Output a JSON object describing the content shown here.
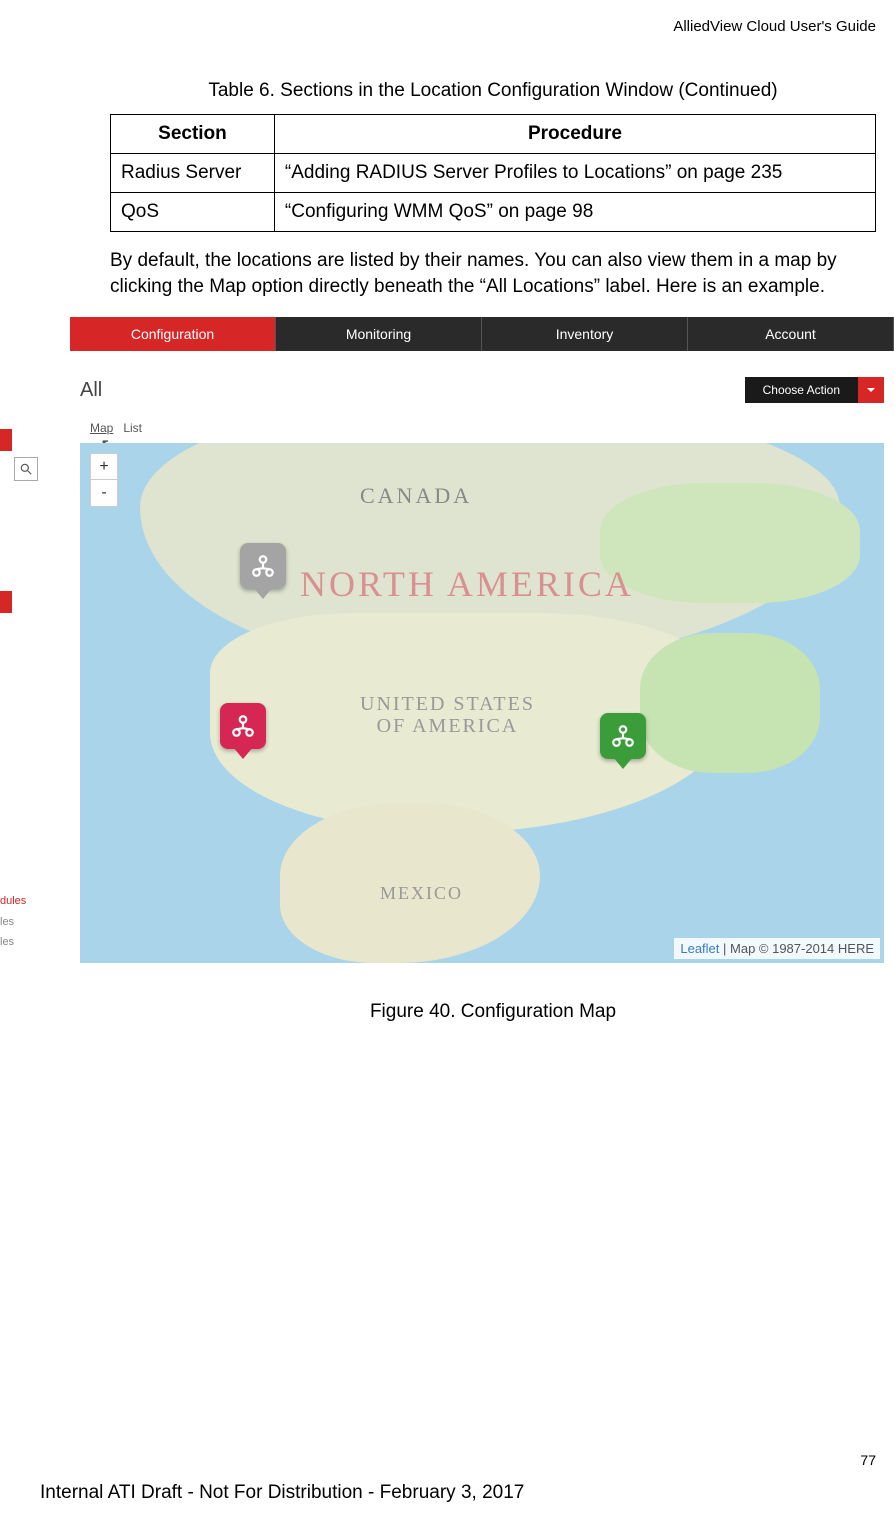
{
  "doc_header": "AlliedView Cloud User's Guide",
  "table_caption": "Table 6. Sections in the Location Configuration Window (Continued)",
  "table": {
    "head": {
      "section": "Section",
      "procedure": "Procedure"
    },
    "rows": [
      {
        "section": "Radius Server",
        "procedure": "“Adding RADIUS Server Profiles to Locations” on page 235"
      },
      {
        "section": "QoS",
        "procedure": "“Configuring WMM QoS” on page 98"
      }
    ]
  },
  "body_text": "By default, the locations are listed by their names. You can also view them in a map by clicking the Map option directly beneath the “All Locations” label. Here is an example.",
  "screenshot": {
    "nav": {
      "configuration": "Configuration",
      "monitoring": "Monitoring",
      "inventory": "Inventory",
      "account": "Account"
    },
    "header": {
      "title": "All",
      "choose_action": "Choose Action"
    },
    "view_toggle": {
      "map": "Map",
      "list": "List"
    },
    "zoom": {
      "in": "+",
      "out": "-"
    },
    "map_labels": {
      "canada": "CANADA",
      "na": "NORTH AMERICA",
      "usa_l1": "UNITED STATES",
      "usa_l2": "OF AMERICA",
      "mexico": "MEXICO"
    },
    "sidebar_labels": {
      "a": "dules",
      "b": "les",
      "c": "les"
    },
    "attribution": {
      "leaflet": "Leaflet",
      "rest": " | Map © 1987-2014 HERE"
    }
  },
  "figure_caption": "Figure 40. Configuration Map",
  "page_number": "77",
  "footer": "Internal ATI Draft - Not For Distribution - February 3, 2017"
}
